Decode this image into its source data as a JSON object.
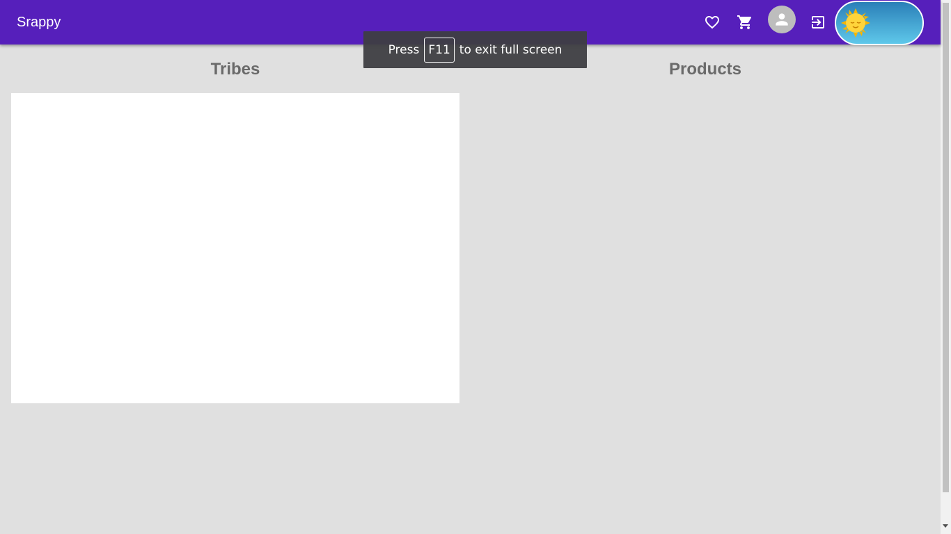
{
  "appbar": {
    "brand": "Srappy",
    "color": "#561fbb",
    "icons": {
      "favorites": "heart-outline-icon",
      "cart": "shopping-cart-icon",
      "avatar": "person-icon",
      "logout": "exit-icon",
      "theme": "sun-icon"
    }
  },
  "fullscreen_notice": {
    "prefix": "Press",
    "key": "F11",
    "suffix": "to exit full screen"
  },
  "sections": {
    "tribes_title": "Tribes",
    "products_title": "Products"
  }
}
